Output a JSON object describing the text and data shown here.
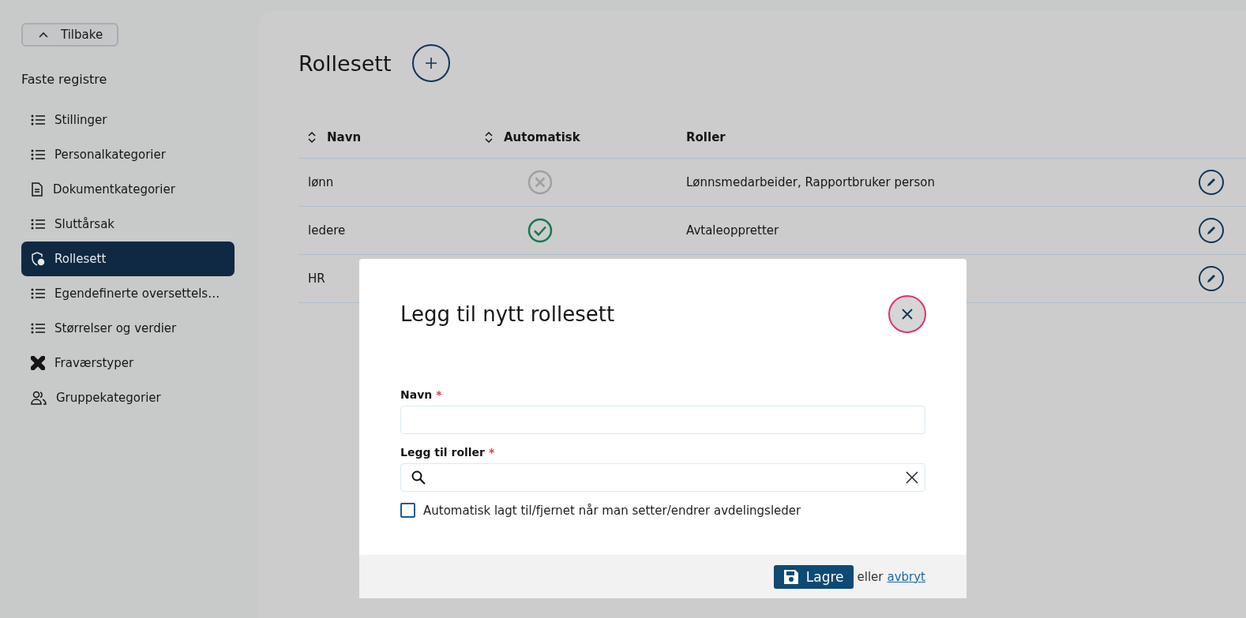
{
  "back_button": {
    "label": "Tilbake"
  },
  "sidebar": {
    "heading": "Faste registre",
    "items": [
      {
        "label": "Stillinger",
        "kind": "list",
        "selected": false
      },
      {
        "label": "Personalkategorier",
        "kind": "list",
        "selected": false
      },
      {
        "label": "Dokumentkategorier",
        "kind": "document",
        "selected": false
      },
      {
        "label": "Sluttårsak",
        "kind": "list",
        "selected": false
      },
      {
        "label": "Rollesett",
        "kind": "shield",
        "selected": true
      },
      {
        "label": "Egendefinerte oversettels…",
        "kind": "list",
        "selected": false
      },
      {
        "label": "Størrelser og verdier",
        "kind": "list",
        "selected": false
      },
      {
        "label": "Fraværstyper",
        "kind": "bandage",
        "selected": false
      },
      {
        "label": "Gruppekategorier",
        "kind": "people",
        "selected": false
      }
    ]
  },
  "page": {
    "title": "Rollesett"
  },
  "table": {
    "columns": [
      {
        "label": "Navn",
        "sortable": true
      },
      {
        "label": "Automatisk",
        "sortable": true
      },
      {
        "label": "Roller",
        "sortable": false
      }
    ],
    "rows": [
      {
        "name": "lønn",
        "automatic": false,
        "roles": "Lønnsmedarbeider, Rapportbruker person"
      },
      {
        "name": "ledere",
        "automatic": true,
        "roles": "Avtaleoppretter"
      },
      {
        "name": "HR"
      }
    ]
  },
  "dialog": {
    "title": "Legg til nytt rollesett",
    "name_field": {
      "label": "Navn",
      "required_mark": "*"
    },
    "roles_field": {
      "label": "Legg til roller",
      "required_mark": "*"
    },
    "auto_checkbox": {
      "label": "Automatisk lagt til/fjernet når man setter/endrer avdelingsleder",
      "checked": false
    },
    "save_button": "Lagre",
    "or_text": "eller",
    "cancel_link": "avbryt"
  }
}
